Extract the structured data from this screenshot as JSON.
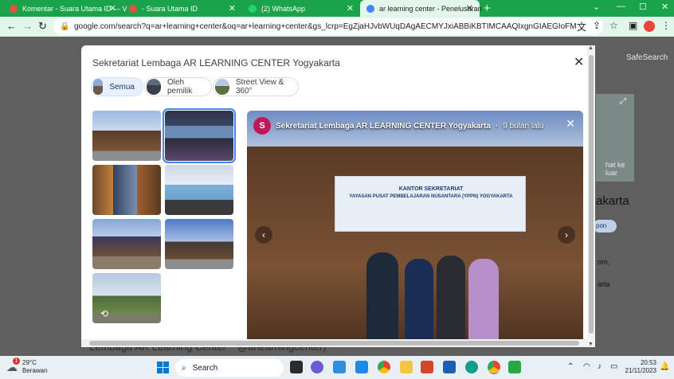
{
  "browser": {
    "tabs": [
      {
        "title": "Komentar - Suara Utama ID — V",
        "favicon_color": "#e0533d"
      },
      {
        "title": "- Suara Utama ID",
        "favicon_color": "#e0533d"
      },
      {
        "title": "(2) WhatsApp",
        "favicon_color": "#25d366"
      },
      {
        "title": "ar learning center - Penelusuran",
        "favicon_color": "#4285f4"
      }
    ],
    "url": "google.com/search?q=ar+learning+center&oq=ar+learning+center&gs_lcrp=EgZjaHJvbWUqDAgAECMYJxiABBiKBTIMCAAQIxgnGIAEGIoFMhUIARAuGMEYrwEYxwEYgAQYigUQYjgU..."
  },
  "background_page": {
    "safesearch": "SafeSearch",
    "partial_lihat": "hat ke luar",
    "partial_yogyakarta": "akarta",
    "partial_rute": "pon",
    "partial_com": "om,",
    "partial_karta": "arta",
    "footer_left": "Lembaga AR Learning Center",
    "footer_right": "@arlearningcenter)"
  },
  "modal": {
    "title": "Sekretariat Lembaga AR LEARNING CENTER Yogyakarta",
    "filters": [
      {
        "label": "Semua",
        "selected": true
      },
      {
        "label": "Oleh pemilik",
        "selected": false
      },
      {
        "label": "Street View & 360°",
        "selected": false
      }
    ],
    "viewer": {
      "avatar_letter": "S",
      "poster": "Sekretariat Lembaga AR LEARNING CENTER Yogyakarta",
      "time_ago": "9 bulan lalu",
      "banner_line1": "KANTOR SEKRETARIAT",
      "banner_line2": "YAYASAN PUSAT PEMBELAJARAN NUSANTARA (YPPN) YOGYAKARTA"
    }
  },
  "taskbar": {
    "weather_badge": "1",
    "temperature": "29°C",
    "condition": "Berawan",
    "search_label": "Search",
    "time": "20:53",
    "date": "21/11/2023"
  }
}
